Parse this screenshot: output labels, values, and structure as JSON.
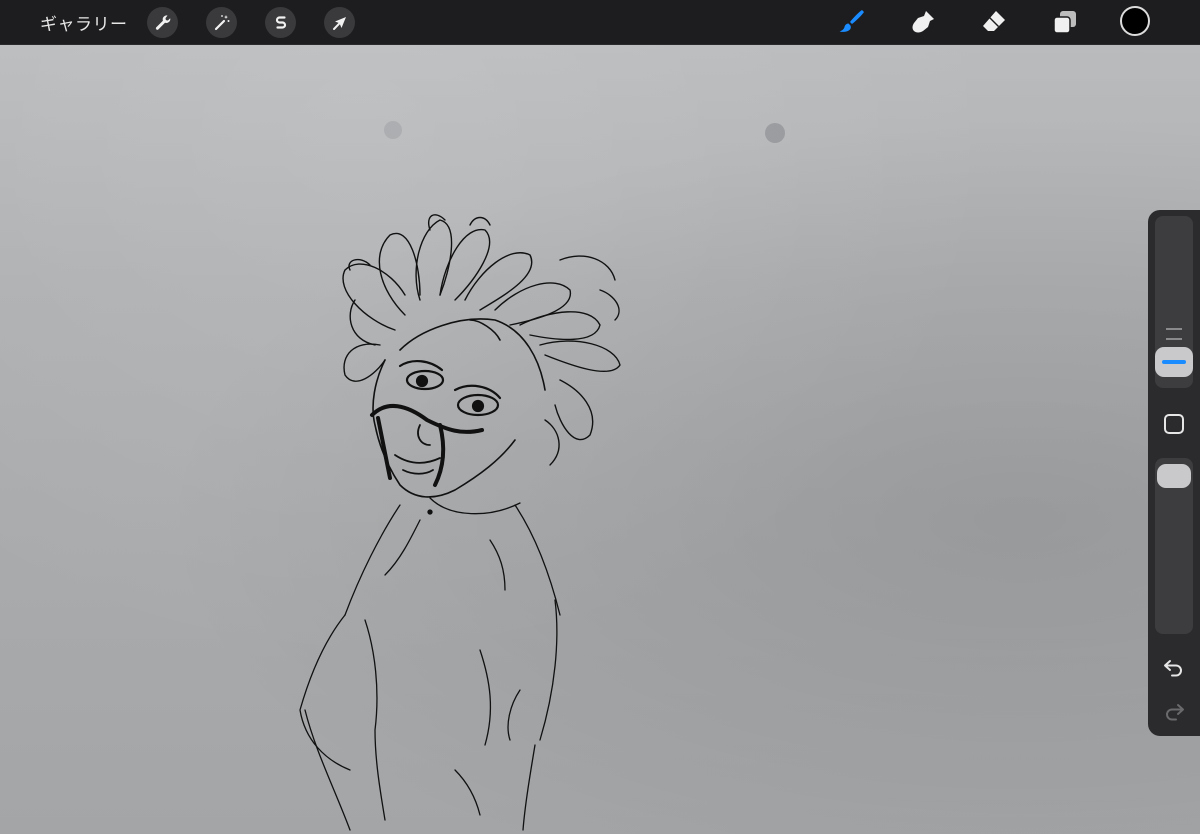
{
  "toolbar": {
    "gallery_label": "ギャラリー",
    "left_tools": [
      {
        "icon": "wrench-icon",
        "name": "actions"
      },
      {
        "icon": "magic-wand-icon",
        "name": "adjustments"
      },
      {
        "icon": "selection-s-icon",
        "name": "selection"
      },
      {
        "icon": "arrow-cursor-icon",
        "name": "transform"
      }
    ],
    "right_tools": [
      {
        "icon": "brush-icon",
        "name": "paint",
        "active": true
      },
      {
        "icon": "smudge-icon",
        "name": "smudge",
        "active": false
      },
      {
        "icon": "eraser-icon",
        "name": "eraser",
        "active": false
      },
      {
        "icon": "layers-icon",
        "name": "layers",
        "active": false
      }
    ],
    "active_color": "#000000",
    "accent_color": "#1a8cff"
  },
  "sidebar": {
    "brush_size": 0.32,
    "brush_opacity": 1.0,
    "modify_button_icon": "square-icon",
    "undo_icon": "undo-icon",
    "redo_icon": "redo-icon"
  }
}
